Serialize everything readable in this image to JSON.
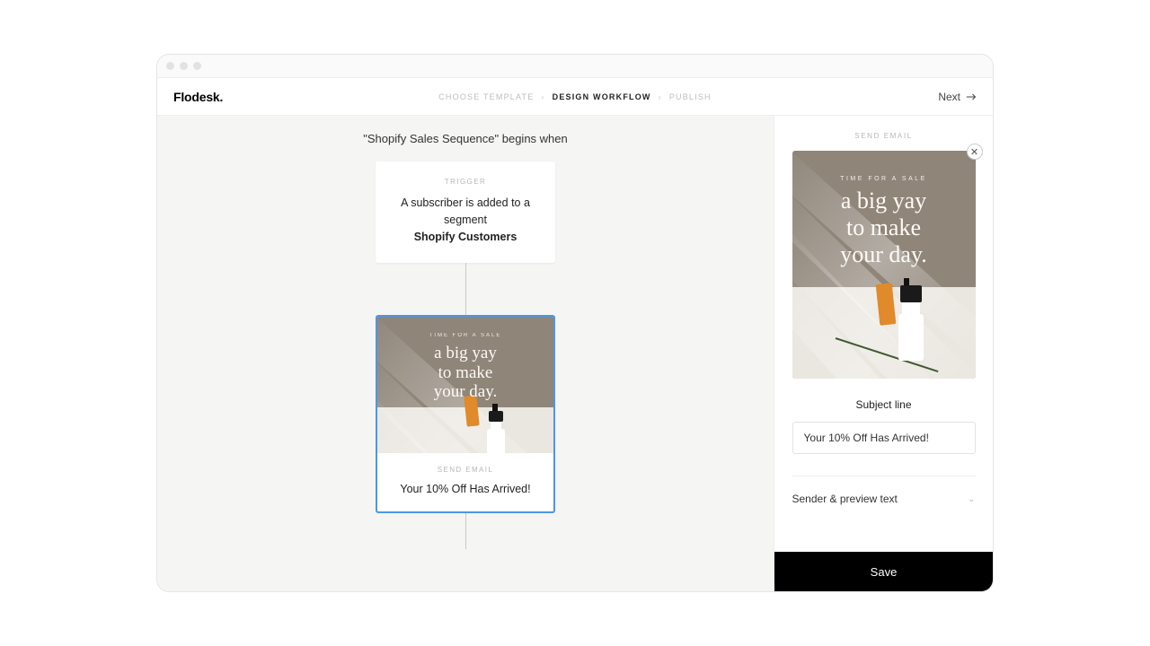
{
  "brand": "Flodesk.",
  "steps": {
    "choose": "Choose Template",
    "design": "Design Workflow",
    "publish": "Publish"
  },
  "next_label": "Next",
  "canvas": {
    "title": "\"Shopify Sales Sequence\" begins when",
    "trigger": {
      "label": "Trigger",
      "line": "A subscriber is added to a segment",
      "segment": "Shopify Customers"
    },
    "email_node": {
      "label": "Send Email",
      "subject": "Your 10% Off Has Arrived!"
    },
    "email_art": {
      "eyebrow": "Time for a sale",
      "line1": "a big yay",
      "line2": "to make",
      "line3": "your day."
    }
  },
  "panel": {
    "title": "Send Email",
    "subject_label": "Subject line",
    "subject_value": "Your 10% Off Has Arrived!",
    "accordion_label": "Sender & preview text",
    "save_label": "Save"
  }
}
